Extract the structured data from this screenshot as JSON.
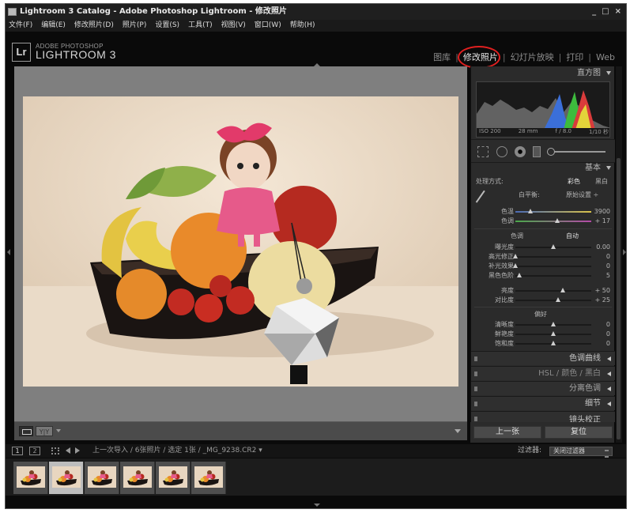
{
  "window": {
    "title": "Lightroom 3 Catalog - Adobe Photoshop Lightroom - 修改照片",
    "controls": [
      "_",
      "□",
      "×"
    ]
  },
  "menu": [
    "文件(F)",
    "编辑(E)",
    "修改照片(D)",
    "照片(P)",
    "设置(S)",
    "工具(T)",
    "视图(V)",
    "窗口(W)",
    "帮助(H)"
  ],
  "identity": {
    "badge": "Lr",
    "brand_small": "ADOBE PHOTOSHOP",
    "brand_large": "LIGHTROOM 3"
  },
  "modules": {
    "library": "图库",
    "develop": "修改照片",
    "slideshow": "幻灯片放映",
    "print": "打印",
    "web": "Web",
    "separator": "|"
  },
  "toolbar": {
    "yy_label": "Y|Y"
  },
  "panel": {
    "histogram": {
      "title": "直方图",
      "iso": "ISO 200",
      "focal": "28 mm",
      "aperture": "f / 8.0",
      "shutter": "1/10 秒"
    },
    "basic": {
      "title": "基本",
      "treatment_label": "处理方式:",
      "treatment_color": "彩色",
      "treatment_bw": "黑白",
      "wb_label": "白平衡:",
      "wb_value": "原始设置 ÷",
      "temp_label": "色温",
      "temp_value": "3900",
      "temp_level": 0.2,
      "tint_label": "色调",
      "tint_value": "+ 17",
      "tint_level": 0.55,
      "tone_label": "色调",
      "auto_label": "自动",
      "exposure_label": "曝光度",
      "exposure_value": "0.00",
      "exposure_level": 0.5,
      "recovery_label": "高光修正",
      "recovery_value": "0",
      "recovery_level": 0.0,
      "fill_label": "补光效果",
      "fill_value": "0",
      "fill_level": 0.0,
      "blacks_label": "黑色色阶",
      "blacks_value": "5",
      "blacks_level": 0.05,
      "brightness_label": "亮度",
      "brightness_value": "+ 50",
      "brightness_level": 0.62,
      "contrast_label": "对比度",
      "contrast_value": "+ 25",
      "contrast_level": 0.56,
      "presence_label": "偏好",
      "clarity_label": "清晰度",
      "clarity_value": "0",
      "clarity_level": 0.5,
      "vibrance_label": "鲜艳度",
      "vibrance_value": "0",
      "vibrance_level": 0.5,
      "saturation_label": "饱和度",
      "saturation_value": "0",
      "saturation_level": 0.5
    },
    "collapsed": [
      "色调曲线",
      "HSL / 颜色 / 黑白",
      "分离色调",
      "细节",
      "镜头校正"
    ],
    "prev_button": "上一张",
    "reset_button": "复位"
  },
  "filmbar": {
    "screen1": "1",
    "screen2": "2",
    "path": "上一次导入 / 6张照片 / 选定 1张 / _MG_9238.CR2 ▾",
    "filter_label": "过滤器:",
    "filter_value": "关闭过滤器"
  },
  "filmstrip": {
    "count": 6,
    "selected_index": 1
  },
  "colors": {
    "accent_circle": "#e02020",
    "panel_bg": "#2b2b2b",
    "canvas_bg": "#7f7f7f"
  }
}
